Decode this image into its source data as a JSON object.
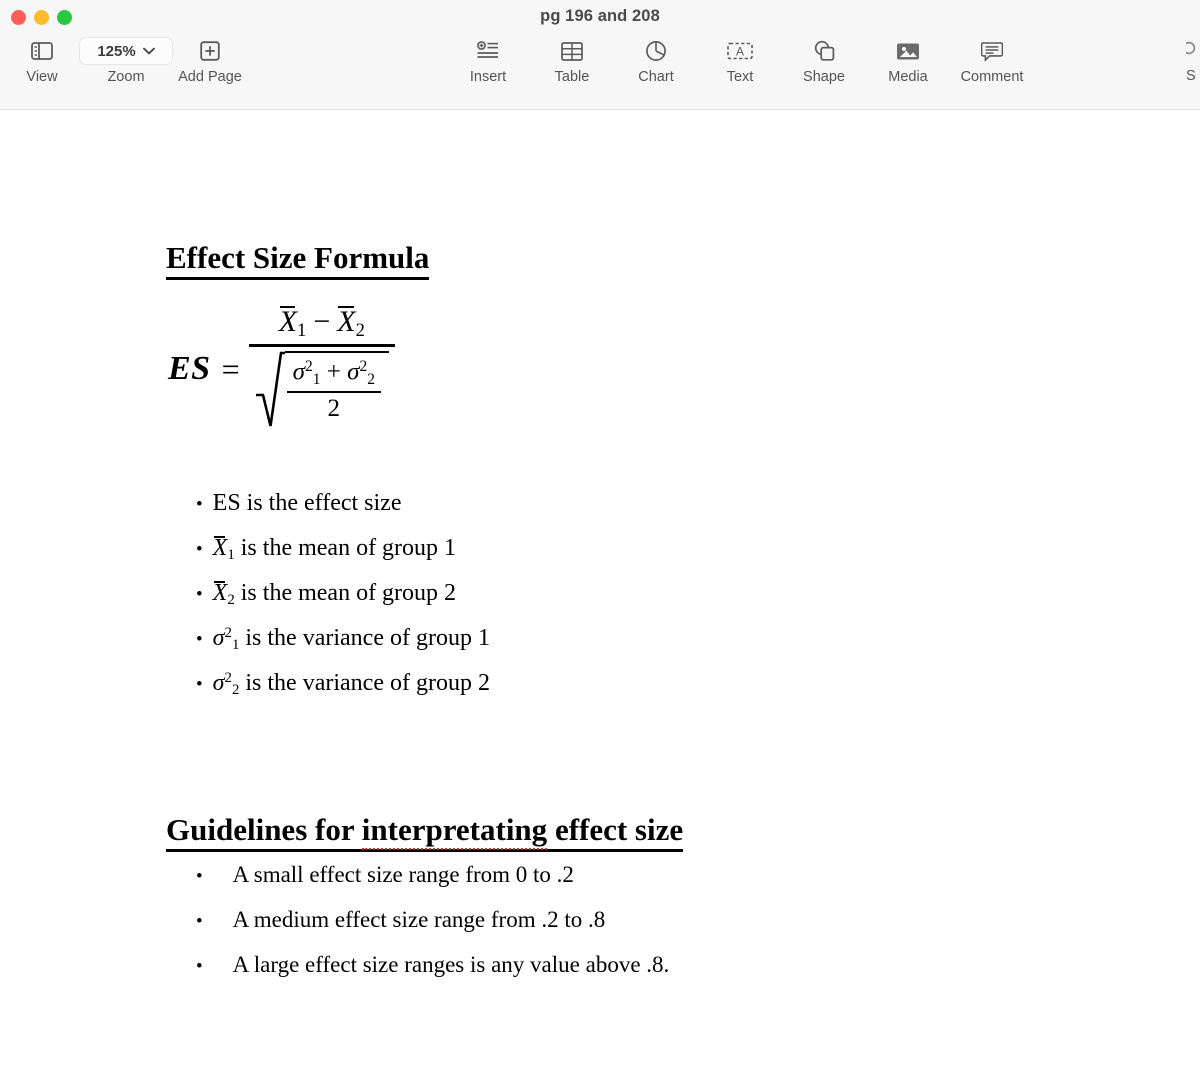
{
  "window": {
    "title": "pg 196 and 208",
    "traffic_lights": [
      {
        "name": "close",
        "color": "#ff5f57"
      },
      {
        "name": "minimize",
        "color": "#febc2e"
      },
      {
        "name": "maximize",
        "color": "#28c840"
      }
    ]
  },
  "toolbar": {
    "left_items": [
      {
        "label": "View",
        "icon": "sidebar-icon"
      },
      {
        "label": "Zoom",
        "icon": "chevron-down-icon",
        "value": "125%"
      },
      {
        "label": "Add Page",
        "icon": "plus-square-icon"
      }
    ],
    "right_items": [
      {
        "label": "Insert",
        "icon": "insert-icon"
      },
      {
        "label": "Table",
        "icon": "table-icon"
      },
      {
        "label": "Chart",
        "icon": "pie-chart-icon"
      },
      {
        "label": "Text",
        "icon": "text-box-icon"
      },
      {
        "label": "Shape",
        "icon": "shape-icon"
      },
      {
        "label": "Media",
        "icon": "media-photo-icon"
      },
      {
        "label": "Comment",
        "icon": "comment-bubble-icon"
      }
    ],
    "cut_off_item": {
      "label": "S"
    }
  },
  "document": {
    "heading_1": "Effect Size Formula",
    "heading_2_part_1": "Guidelines for ",
    "heading_2_misspelled": "interpretating",
    "heading_2_part_2": " effect size",
    "formula": {
      "lhs": "ES",
      "equals": "=",
      "numerator_first": "X",
      "numerator_first_sub": "1",
      "numerator_operator": "−",
      "numerator_second": "X",
      "numerator_second_sub": "2",
      "radicand_first": "σ",
      "radicand_first_sub": "1",
      "radicand_first_sup": "2",
      "radicand_operator": "+",
      "radicand_second": "σ",
      "radicand_second_sub": "2",
      "radicand_second_sup": "2",
      "radicand_denominator": "2"
    },
    "definitions": [
      {
        "symbol_text": "ES",
        "symbol_sub": "",
        "symbol_sup": "",
        "description": "is the effect size",
        "overline": false
      },
      {
        "symbol_text": "X",
        "symbol_sub": "1",
        "symbol_sup": "",
        "description": "is the mean of group 1",
        "overline": true
      },
      {
        "symbol_text": "X",
        "symbol_sub": "2",
        "symbol_sup": "",
        "description": "is the mean of group 2",
        "overline": true
      },
      {
        "symbol_text": "σ",
        "symbol_sub": "1",
        "symbol_sup": "2",
        "description": "is the variance of group 1",
        "overline": false
      },
      {
        "symbol_text": "σ",
        "symbol_sub": "2",
        "symbol_sup": "2",
        "description": "is the variance of group 2",
        "overline": false
      }
    ],
    "guidelines": [
      "A small effect size range from 0 to .2",
      "A medium effect size range from .2 to .8",
      "A large effect size ranges is any value above .8."
    ],
    "bullet_glyph": "•"
  }
}
